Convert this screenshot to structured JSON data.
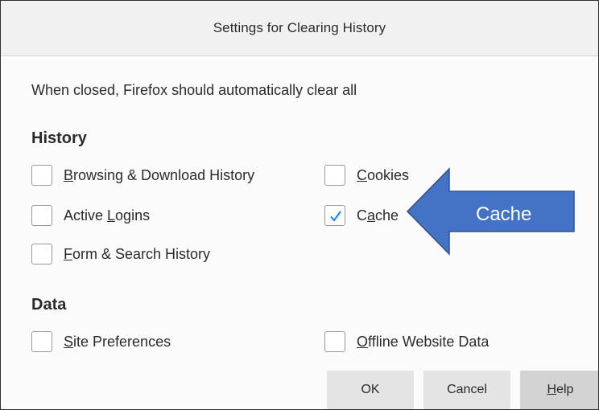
{
  "dialog": {
    "title": "Settings for Clearing History",
    "description": "When closed, Firefox should automatically clear all"
  },
  "history": {
    "heading": "History",
    "items": [
      {
        "pre": "",
        "mnemonic": "B",
        "post": "rowsing & Download History",
        "checked": false
      },
      {
        "pre": "",
        "mnemonic": "C",
        "post": "ookies",
        "checked": false
      },
      {
        "pre": "Active ",
        "mnemonic": "L",
        "post": "ogins",
        "checked": false
      },
      {
        "pre": "C",
        "mnemonic": "a",
        "post": "che",
        "checked": true
      },
      {
        "pre": "",
        "mnemonic": "F",
        "post": "orm & Search History",
        "checked": false
      }
    ]
  },
  "data_section": {
    "heading": "Data",
    "items": [
      {
        "pre": "",
        "mnemonic": "S",
        "post": "ite Preferences",
        "checked": false
      },
      {
        "pre": "",
        "mnemonic": "O",
        "post": "ffline Website Data",
        "checked": false
      }
    ]
  },
  "buttons": {
    "ok": "OK",
    "cancel": "Cancel",
    "help_mnemonic": "H",
    "help_rest": "elp"
  },
  "annotation": {
    "label": "Cache",
    "fill_color": "#4472c4",
    "border_color": "#2f528f"
  },
  "colors": {
    "checkmark": "#0a84ff"
  }
}
